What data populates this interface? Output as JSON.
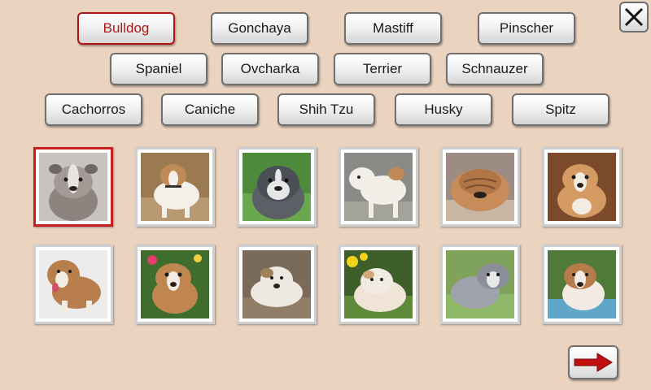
{
  "breeds": {
    "bulldog": "Bulldog",
    "gonchaya": "Gonchaya",
    "mastiff": "Mastiff",
    "pinscher": "Pinscher",
    "spaniel": "Spaniel",
    "ovcharka": "Ovcharka",
    "terrier": "Terrier",
    "schnauzer": "Schnauzer",
    "cachorros": "Cachorros",
    "caniche": "Caniche",
    "shih_tzu": "Shih Tzu",
    "husky": "Husky",
    "spitz": "Spitz"
  },
  "selected_breed": "Bulldog",
  "icons": {
    "close": "close-icon",
    "next": "arrow-right-icon"
  },
  "colors": {
    "background": "#ead3bf",
    "selected_accent": "#b01515",
    "arrow": "#c01010"
  },
  "thumbnails": [
    {
      "id": "bulldog-photo-1",
      "selected": true
    },
    {
      "id": "bulldog-photo-2",
      "selected": false
    },
    {
      "id": "bulldog-photo-3",
      "selected": false
    },
    {
      "id": "bulldog-photo-4",
      "selected": false
    },
    {
      "id": "bulldog-photo-5",
      "selected": false
    },
    {
      "id": "bulldog-photo-6",
      "selected": false
    },
    {
      "id": "bulldog-photo-7",
      "selected": false
    },
    {
      "id": "bulldog-photo-8",
      "selected": false
    },
    {
      "id": "bulldog-photo-9",
      "selected": false
    },
    {
      "id": "bulldog-photo-10",
      "selected": false
    },
    {
      "id": "bulldog-photo-11",
      "selected": false
    },
    {
      "id": "bulldog-photo-12",
      "selected": false
    }
  ]
}
